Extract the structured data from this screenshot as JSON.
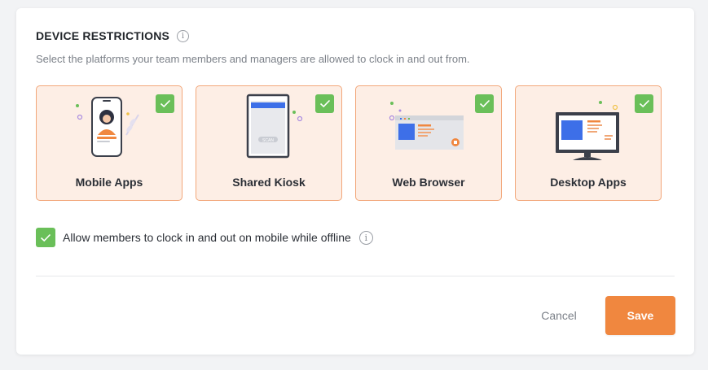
{
  "section": {
    "title": "DEVICE RESTRICTIONS",
    "subtitle": "Select the platforms your team members and managers are allowed to clock in and out from."
  },
  "platforms": [
    {
      "label": "Mobile Apps",
      "checked": true,
      "icon": "mobile-phone-illustration"
    },
    {
      "label": "Shared Kiosk",
      "checked": true,
      "icon": "kiosk-illustration"
    },
    {
      "label": "Web Browser",
      "checked": true,
      "icon": "browser-window-illustration"
    },
    {
      "label": "Desktop Apps",
      "checked": true,
      "icon": "desktop-monitor-illustration"
    }
  ],
  "offline": {
    "label": "Allow members to clock in and out on mobile while offline",
    "checked": true
  },
  "actions": {
    "cancel_label": "Cancel",
    "save_label": "Save"
  },
  "kiosk_scan_text": "SCAN",
  "colors": {
    "accent": "#f0873f",
    "check_green": "#6abf59",
    "card_bg": "#fdeee5",
    "card_border": "#f2a77a",
    "illustration_blue": "#3d6fe8"
  }
}
